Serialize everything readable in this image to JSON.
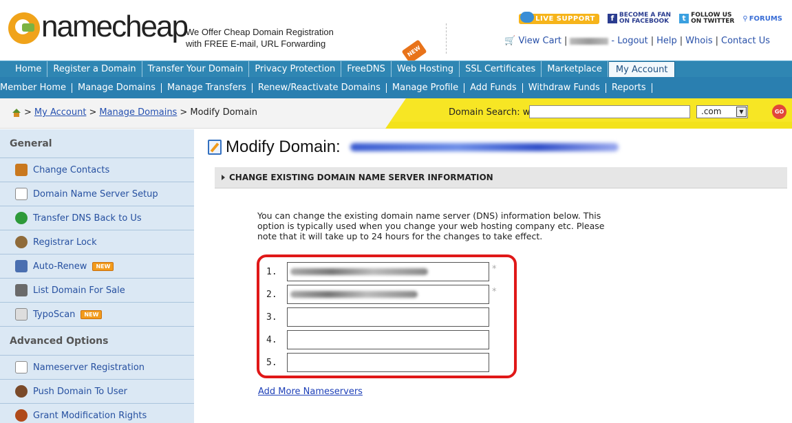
{
  "header": {
    "logo_text": "namecheap",
    "tagline_1": "We Offer Cheap Domain Registration",
    "tagline_2": "with FREE E-mail, URL Forwarding",
    "live_support": "LIVE SUPPORT",
    "facebook_1": "BECOME A FAN",
    "facebook_2": "ON FACEBOOK",
    "twitter_1": "FOLLOW US",
    "twitter_2": "ON TWITTER",
    "forums": "FORUMS",
    "view_cart": "View Cart",
    "logout": "- Logout",
    "help": "Help",
    "whois": "Whois",
    "contact": "Contact Us"
  },
  "nav": {
    "items": [
      "Home",
      "Register a Domain",
      "Transfer Your Domain",
      "Privacy Protection",
      "FreeDNS",
      "Web Hosting",
      "SSL Certificates",
      "Marketplace",
      "My Account"
    ],
    "new_tag": "NEW"
  },
  "subnav": {
    "items": [
      "Member Home",
      "Manage Domains",
      "Manage Transfers",
      "Renew/Reactivate Domains",
      "Manage Profile",
      "Add Funds",
      "Withdraw Funds",
      "Reports"
    ]
  },
  "breadcrumb": {
    "sep": ">",
    "my_account": "My Account",
    "manage_domains": "Manage Domains",
    "current": "> Modify Domain"
  },
  "domain_search": {
    "label": "Domain Search: www.",
    "tld": ".com",
    "go": "GO"
  },
  "sidebar": {
    "general_title": "General",
    "general": [
      {
        "label": "Change Contacts",
        "color": "#c9781e"
      },
      {
        "label": "Domain Name Server Setup",
        "color": "#888888"
      },
      {
        "label": "Transfer DNS Back to Us",
        "color": "#2e9a3a"
      },
      {
        "label": "Registrar Lock",
        "color": "#8f6b3a"
      },
      {
        "label": "Auto-Renew",
        "color": "#4a6fb0",
        "new": "NEW"
      },
      {
        "label": "List Domain For Sale",
        "color": "#6a6a6a"
      },
      {
        "label": "TypoScan",
        "color": "#9a9a9a",
        "new": "NEW"
      }
    ],
    "advanced_title": "Advanced Options",
    "advanced": [
      {
        "label": "Nameserver Registration",
        "color": "#8a8a8a"
      },
      {
        "label": "Push Domain To User",
        "color": "#7a4a2a"
      },
      {
        "label": "Grant Modification Rights",
        "color": "#b04a1a"
      }
    ]
  },
  "main": {
    "title": "Modify Domain:",
    "section": "CHANGE EXISTING DOMAIN NAME SERVER INFORMATION",
    "desc_1": "You can change the existing domain name server (DNS) information below. This",
    "desc_2": "option is typically used when you change your web hosting company etc. Please",
    "desc_3": "note that it will take up to 24 hours for the changes to take effect.",
    "nameservers": [
      {
        "num": "1."
      },
      {
        "num": "2."
      },
      {
        "num": "3."
      },
      {
        "num": "4."
      },
      {
        "num": "5."
      }
    ],
    "required_mark": "*",
    "add_more": "Add More Nameservers"
  }
}
